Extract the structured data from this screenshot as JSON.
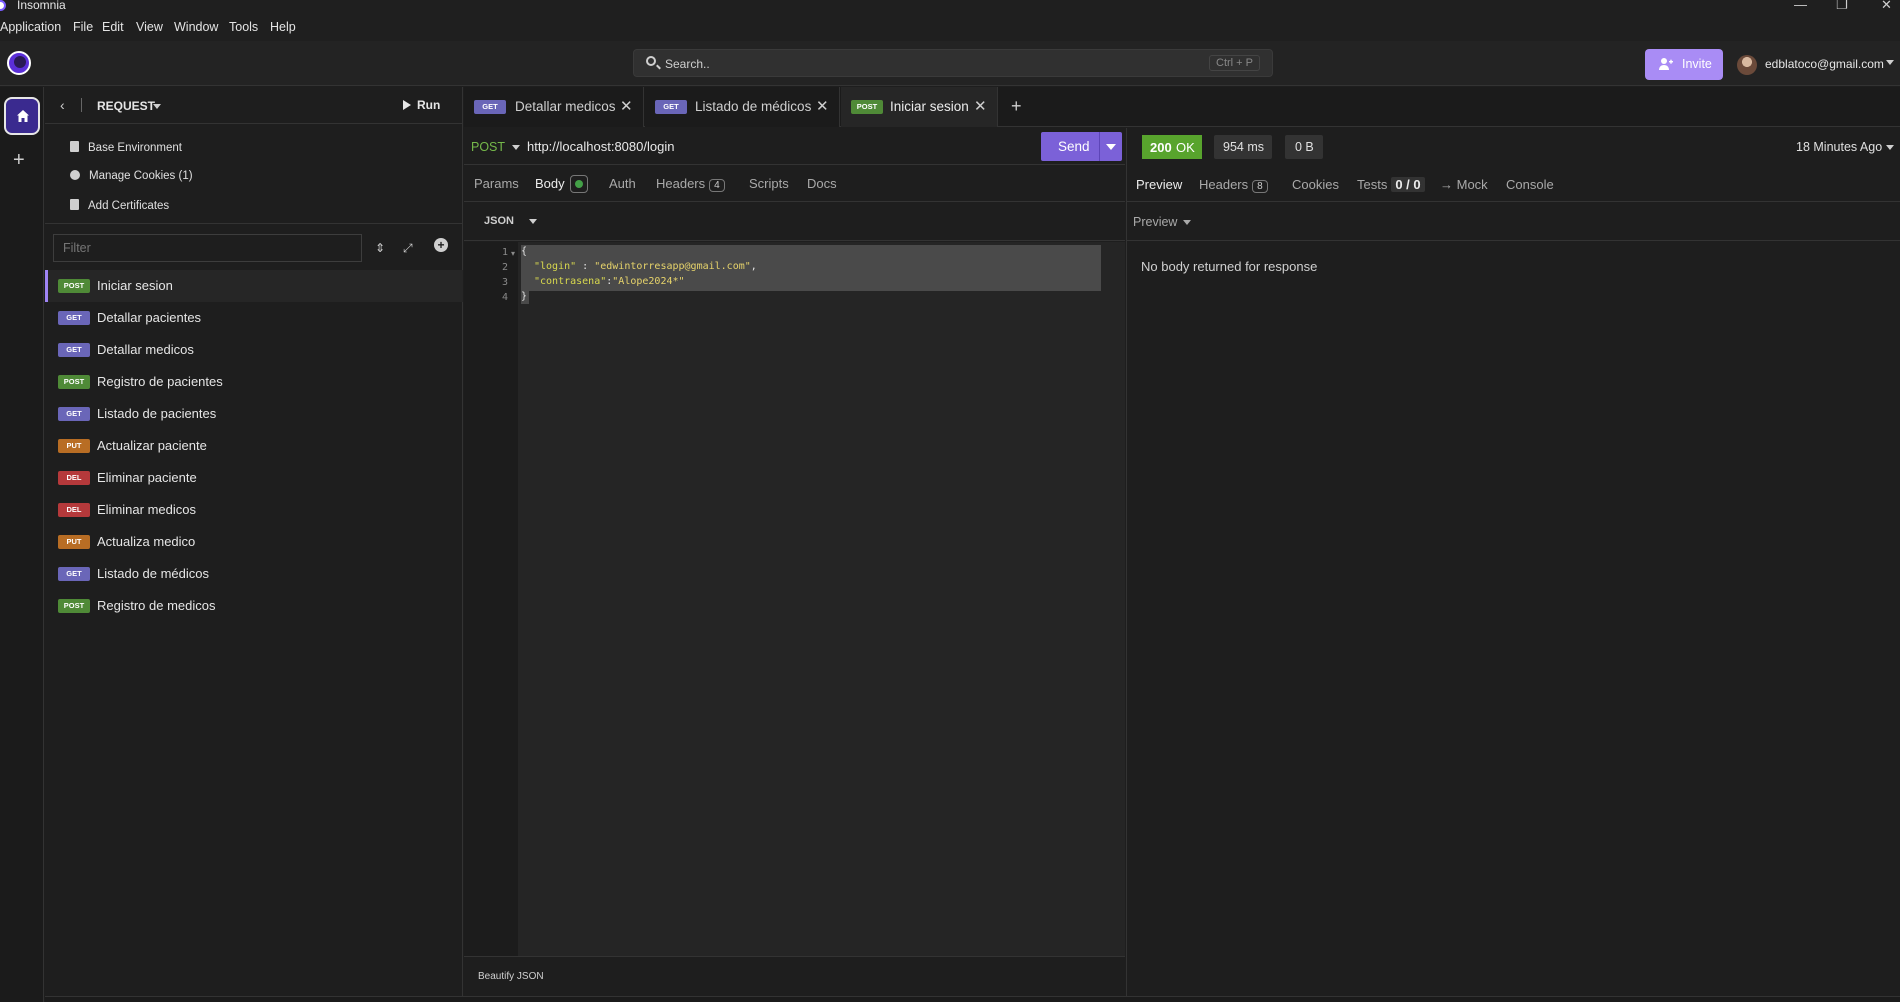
{
  "window": {
    "title": "Insomnia",
    "minimize": "—",
    "restore": "❐",
    "close": "✕"
  },
  "menu": [
    "Application",
    "File",
    "Edit",
    "View",
    "Window",
    "Tools",
    "Help"
  ],
  "header": {
    "search_placeholder": "Search..",
    "search_shortcut": "Ctrl + P",
    "invite_label": "Invite",
    "user_email": "edblatoco@gmail.com"
  },
  "sidebar": {
    "section_label": "REQUEST",
    "run_label": "Run",
    "links": [
      "Base Environment",
      "Manage Cookies (1)",
      "Add Certificates"
    ],
    "filter_placeholder": "Filter",
    "requests": [
      {
        "method": "POST",
        "name": "Iniciar sesion",
        "active": true
      },
      {
        "method": "GET",
        "name": "Detallar pacientes"
      },
      {
        "method": "GET",
        "name": "Detallar medicos"
      },
      {
        "method": "POST",
        "name": "Registro de pacientes"
      },
      {
        "method": "GET",
        "name": "Listado de pacientes"
      },
      {
        "method": "PUT",
        "name": "Actualizar paciente"
      },
      {
        "method": "DEL",
        "name": "Eliminar paciente"
      },
      {
        "method": "DEL",
        "name": "Eliminar medicos"
      },
      {
        "method": "PUT",
        "name": "Actualiza medico"
      },
      {
        "method": "GET",
        "name": "Listado de médicos"
      },
      {
        "method": "POST",
        "name": "Registro de medicos"
      }
    ]
  },
  "tabs": [
    {
      "method": "GET",
      "name": "Detallar medicos"
    },
    {
      "method": "GET",
      "name": "Listado de médicos"
    },
    {
      "method": "POST",
      "name": "Iniciar sesion",
      "active": true
    }
  ],
  "request": {
    "method": "POST",
    "url": "http://localhost:8080/login",
    "send_label": "Send",
    "subtabs": {
      "params": "Params",
      "body": "Body",
      "auth": "Auth",
      "headers": "Headers",
      "headers_count": "4",
      "scripts": "Scripts",
      "docs": "Docs"
    },
    "body_type": "JSON",
    "line_numbers": [
      "1",
      "2",
      "3",
      "4"
    ],
    "body_lines": {
      "open": "{",
      "key1": "\"login\"",
      "sep1": " : ",
      "val1": "\"edwintorresapp@gmail.com\"",
      "comma": ",",
      "key2": "\"contrasena\"",
      "sep2": ":",
      "val2": "\"Alope2024*\"",
      "close": "}"
    },
    "beautify_label": "Beautify JSON"
  },
  "response": {
    "status_code": "200",
    "status_text": "OK",
    "time": "954 ms",
    "size": "0 B",
    "when": "18 Minutes Ago",
    "tabs": {
      "preview": "Preview",
      "headers": "Headers",
      "headers_count": "8",
      "cookies": "Cookies",
      "tests": "Tests",
      "tests_count": "0 / 0",
      "mock": "→ Mock",
      "console": "Console"
    },
    "preview_mode": "Preview",
    "empty_message": "No body returned for response"
  },
  "colors": {
    "accent": "#7b61d8",
    "get": "#6a66b8",
    "post": "#4f8a37",
    "put": "#b86d24",
    "del": "#b5393b",
    "ok": "#58a42d"
  }
}
